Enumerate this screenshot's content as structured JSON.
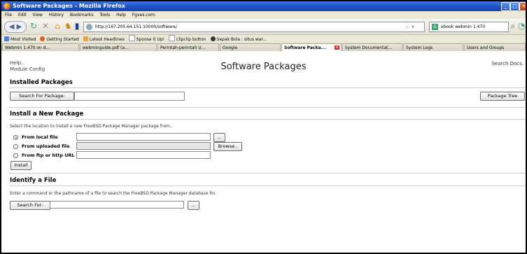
{
  "window": {
    "title": "Software Packages - Mozilla Firefox",
    "controls": [
      "_",
      "□",
      "✕"
    ]
  },
  "menu": [
    "File",
    "Edit",
    "View",
    "History",
    "Bookmarks",
    "Tools",
    "Help",
    "Fgves.com"
  ],
  "nav": {
    "url": "http://167.205.64.151:10000/software/",
    "search_value": "ebook webmin 1.470"
  },
  "bookmarks": [
    {
      "label": "Most Visited"
    },
    {
      "label": "Getting Started"
    },
    {
      "label": "Latest Headlines"
    },
    {
      "label": "Spoose It Up!"
    },
    {
      "label": "clipclip button"
    },
    {
      "label": "Sepak Bola : situs war..."
    }
  ],
  "tabs": [
    {
      "label": "Webmin 1.470 on d..."
    },
    {
      "label": "webminguide.pdf (a..."
    },
    {
      "label": "Perintah-perintah U..."
    },
    {
      "label": "Google"
    },
    {
      "label": "Software Packa..."
    },
    {
      "label": "System Documentat..."
    },
    {
      "label": "System Logs"
    },
    {
      "label": "Users and Groups"
    }
  ],
  "page": {
    "help_link": "Help..",
    "module_config_link": "Module Config",
    "title": "Software Packages",
    "search_docs_link": "Search Docs.",
    "installed": {
      "heading": "Installed Packages",
      "search_button": "Search For Package:",
      "search_value": "",
      "tree_button": "Package Tree"
    },
    "install": {
      "heading": "Install a New Package",
      "description": "Select the location to install a new FreeBSD Package Manager package from..",
      "local_label": "From local file",
      "uploaded_label": "From uploaded file",
      "ftp_label": "From ftp or http URL",
      "browse_small": "...",
      "browse_button": "Browse..",
      "install_button": "Install",
      "selected": "local"
    },
    "identify": {
      "heading": "Identify a File",
      "description": "Enter a command or the pathname of a file to search the FreeBSD Package Manager database for.",
      "search_button": "Search For:",
      "browse_small": "..."
    }
  }
}
